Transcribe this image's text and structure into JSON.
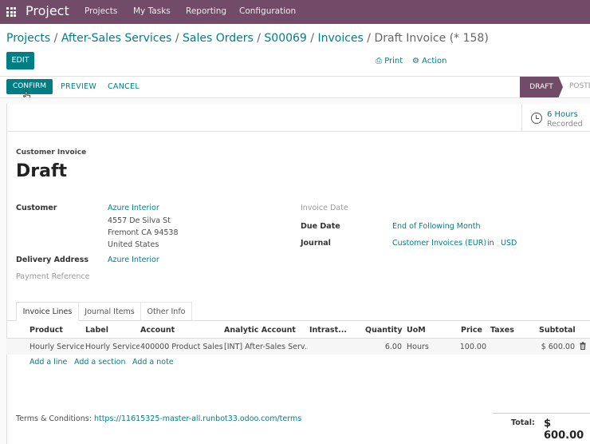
{
  "topnav": {
    "app_name": "Project",
    "menus": [
      "Projects",
      "My Tasks",
      "Reporting",
      "Configuration"
    ]
  },
  "breadcrumb": {
    "items": [
      "Projects",
      "After-Sales Services",
      "Sales Orders",
      "S00069",
      "Invoices"
    ],
    "current": "Draft Invoice (* 158)"
  },
  "control_panel": {
    "edit_label": "EDIT",
    "print_label": "Print",
    "action_label": "Action"
  },
  "statusbar": {
    "confirm_label": "CONFIRM",
    "preview_label": "PREVIEW",
    "cancel_label": "CANCEL",
    "stage_active": "DRAFT",
    "stage_next": "POSTE"
  },
  "stat_button": {
    "value": "6 Hours",
    "label": "Recorded"
  },
  "invoice": {
    "type": "Customer Invoice",
    "name": "Draft",
    "customer_label": "Customer",
    "customer": "Azure Interior",
    "address_line1": "4557 De Silva St",
    "address_line2": "Fremont CA 94538",
    "address_line3": "United States",
    "delivery_label": "Delivery Address",
    "delivery": "Azure Interior",
    "payment_ref_label": "Payment Reference",
    "invoice_date_label": "Invoice Date",
    "due_date_label": "Due Date",
    "due_date": "End of Following Month",
    "journal_label": "Journal",
    "journal": "Customer Invoices (EUR)",
    "journal_in": "in",
    "currency": "USD"
  },
  "tabs": [
    "Invoice Lines",
    "Journal Items",
    "Other Info"
  ],
  "table": {
    "headers": [
      "Product",
      "Label",
      "Account",
      "Analytic Account",
      "Intrast...",
      "Quantity",
      "UoM",
      "Price",
      "Taxes",
      "Subtotal"
    ],
    "rows": [
      [
        "Hourly Service",
        "Hourly Service",
        "400000 Product Sales",
        "[INT] After-Sales Serv...",
        "",
        "6.00",
        "Hours",
        "100.00",
        "",
        "$ 600.00"
      ]
    ],
    "add_line": "Add a line",
    "add_section": "Add a section",
    "add_note": "Add a note"
  },
  "footer": {
    "terms_label": "Terms & Conditions:",
    "terms_link": "https://11615325-master-all.runbot33.odoo.com/terms",
    "total_label": "Total:",
    "total_value": "$ 600.00"
  },
  "colors": {
    "brand": "#714b67",
    "accent": "#017e84"
  }
}
